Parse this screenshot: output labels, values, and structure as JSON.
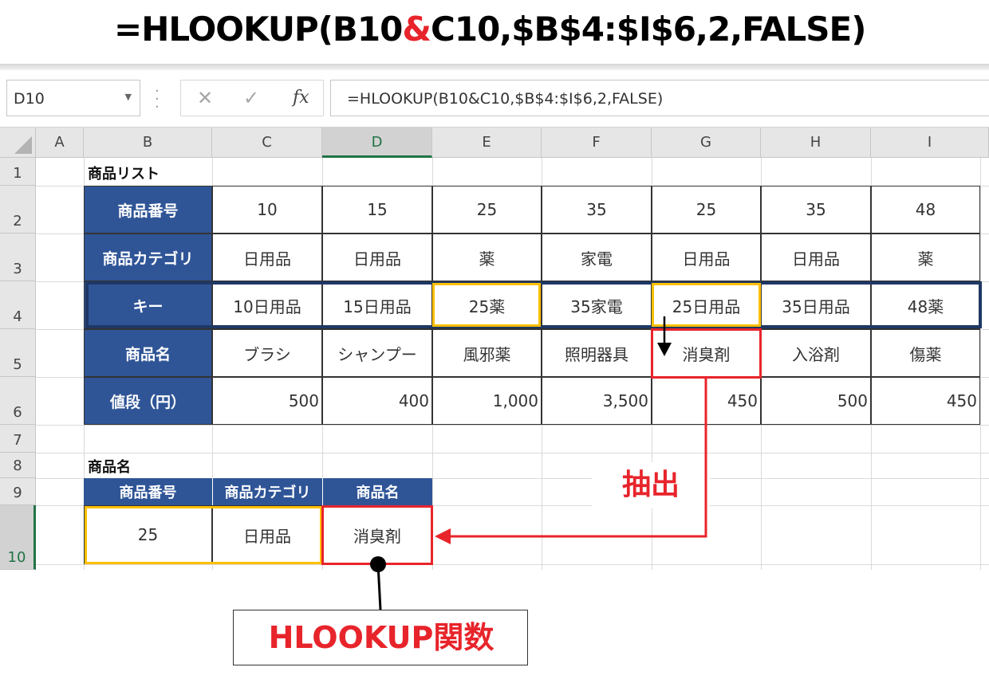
{
  "banner": {
    "formula_part1": "=HLOOKUP(B10",
    "formula_amp": "&",
    "formula_part2": "C10,$B$4:$I$6,2,FALSE)"
  },
  "formula_bar": {
    "name_box": "D10",
    "cancel_icon": "✕",
    "enter_icon": "✓",
    "fx_label": "fx",
    "formula": "=HLOOKUP(B10&C10,$B$4:$I$6,2,FALSE)"
  },
  "columns": [
    "A",
    "B",
    "C",
    "D",
    "E",
    "F",
    "G",
    "H",
    "I"
  ],
  "rows": [
    "1",
    "2",
    "3",
    "4",
    "5",
    "6",
    "7",
    "8",
    "9",
    "10"
  ],
  "sheet": {
    "title": "商品リスト",
    "table": {
      "row_headers": [
        "商品番号",
        "商品カテゴリ",
        "キー",
        "商品名",
        "値段（円）"
      ],
      "product_numbers": [
        "10",
        "15",
        "25",
        "35",
        "25",
        "35",
        "48"
      ],
      "categories": [
        "日用品",
        "日用品",
        "薬",
        "家電",
        "日用品",
        "日用品",
        "薬"
      ],
      "keys": [
        "10日用品",
        "15日用品",
        "25薬",
        "35家電",
        "25日用品",
        "35日用品",
        "48薬"
      ],
      "product_names": [
        "ブラシ",
        "シャンプー",
        "風邪薬",
        "照明器具",
        "消臭剤",
        "入浴剤",
        "傷薬"
      ],
      "prices": [
        "500",
        "400",
        "1,000",
        "3,500",
        "450",
        "500",
        "450"
      ]
    },
    "lookup_title": "商品名",
    "lookup": {
      "headers": [
        "商品番号",
        "商品カテゴリ",
        "商品名"
      ],
      "values": [
        "25",
        "日用品",
        "消臭剤"
      ]
    }
  },
  "annotations": {
    "extract_label": "抽出",
    "function_label": "HLOOKUP関数"
  },
  "colors": {
    "header_fill": "#2f5597",
    "key_row_border": "#1f3864",
    "gold_highlight": "#ffc000",
    "red_highlight": "#e8242b",
    "excel_green": "#217346"
  }
}
